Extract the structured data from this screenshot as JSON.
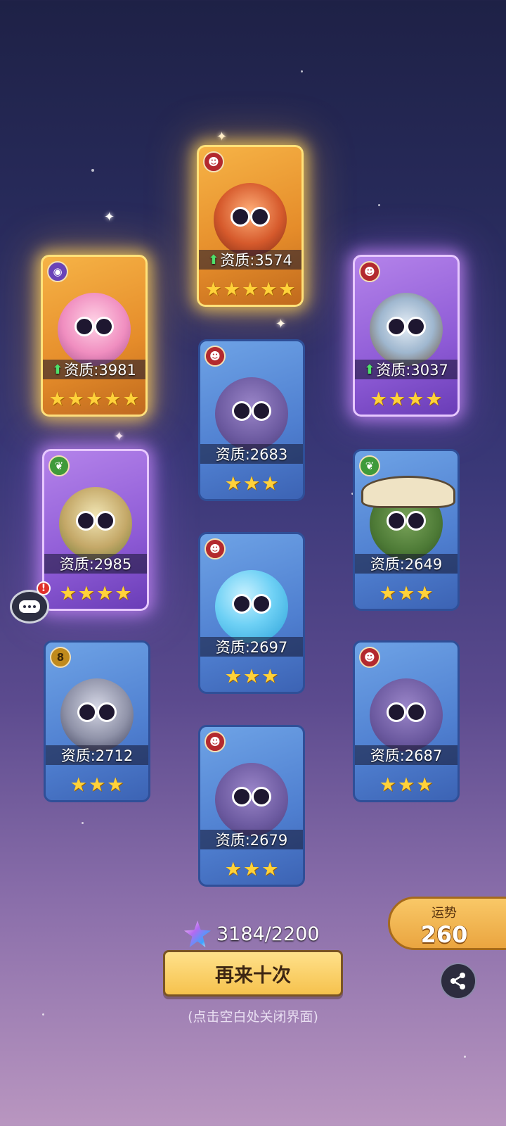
{
  "stat_prefix": "资质:",
  "cards": [
    {
      "id": "lion",
      "tier": "gold",
      "element": "fire",
      "stat": "3574",
      "stars": 5,
      "upgraded": true,
      "creature": "lion"
    },
    {
      "id": "pink-girl",
      "tier": "gold",
      "element": "arcane",
      "stat": "3981",
      "stars": 5,
      "upgraded": true,
      "creature": "girl"
    },
    {
      "id": "hooded",
      "tier": "purple",
      "element": "fire",
      "stat": "3037",
      "stars": 4,
      "upgraded": true,
      "creature": "hooded"
    },
    {
      "id": "spiky-1",
      "tier": "blue",
      "element": "fire",
      "stat": "2683",
      "stars": 3,
      "upgraded": false,
      "creature": "spiky"
    },
    {
      "id": "knight",
      "tier": "purple",
      "element": "nature",
      "stat": "2985",
      "stars": 4,
      "upgraded": false,
      "creature": "knight"
    },
    {
      "id": "cactus",
      "tier": "blue",
      "element": "nature",
      "stat": "2649",
      "stars": 3,
      "upgraded": false,
      "creature": "cactus"
    },
    {
      "id": "slime",
      "tier": "blue",
      "element": "fire",
      "stat": "2697",
      "stars": 3,
      "upgraded": false,
      "creature": "slime"
    },
    {
      "id": "ogre",
      "tier": "blue",
      "element": "gold",
      "stat": "2712",
      "stars": 3,
      "upgraded": false,
      "creature": "ogre"
    },
    {
      "id": "spiky-2",
      "tier": "blue",
      "element": "fire",
      "stat": "2687",
      "stars": 3,
      "upgraded": false,
      "creature": "spiky"
    },
    {
      "id": "spiky-3",
      "tier": "blue",
      "element": "fire",
      "stat": "2679",
      "stars": 3,
      "upgraded": false,
      "creature": "spiky"
    }
  ],
  "currency": {
    "text": "3184/2200",
    "icon": "star-gem-icon"
  },
  "retry_button": "再来十次",
  "hint": "(点击空白处关闭界面)",
  "fortune": {
    "label": "运势",
    "value": "260"
  },
  "alert_badge": "!",
  "colors": {
    "gold_tier": "#f6b346",
    "purple_tier": "#b483ea",
    "blue_tier": "#6ea3e6",
    "star": "#ffd23a",
    "upgrade_arrow": "#4fe06a"
  }
}
